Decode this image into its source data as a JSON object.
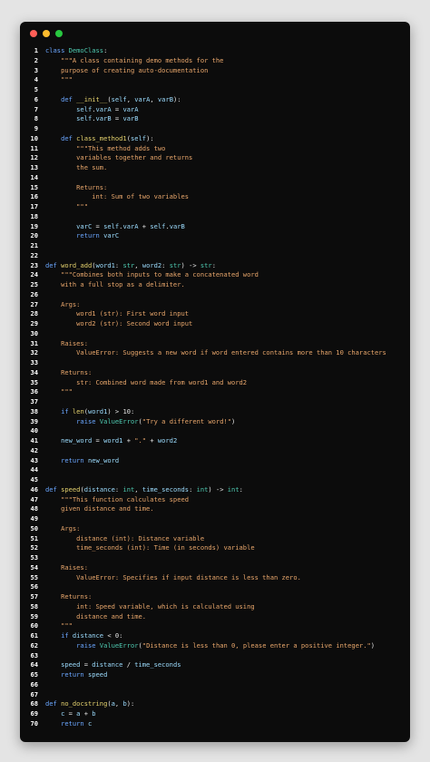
{
  "window": {
    "controls": [
      "close",
      "minimize",
      "maximize"
    ]
  },
  "lines": [
    {
      "n": "1",
      "t": [
        [
          "kw",
          "class "
        ],
        [
          "cls",
          "DemoClass"
        ],
        [
          "plain",
          ":"
        ]
      ]
    },
    {
      "n": "2",
      "t": [
        [
          "str",
          "    \"\"\"A class containing demo methods for the"
        ]
      ]
    },
    {
      "n": "3",
      "t": [
        [
          "str",
          "    purpose of creating auto-documentation"
        ]
      ]
    },
    {
      "n": "4",
      "t": [
        [
          "str",
          "    \"\"\""
        ]
      ]
    },
    {
      "n": "5",
      "t": []
    },
    {
      "n": "6",
      "t": [
        [
          "kw",
          "    def "
        ],
        [
          "fn",
          "__init__"
        ],
        [
          "plain",
          "("
        ],
        [
          "id",
          "self"
        ],
        [
          "plain",
          ", "
        ],
        [
          "id",
          "varA"
        ],
        [
          "plain",
          ", "
        ],
        [
          "id",
          "varB"
        ],
        [
          "plain",
          "):"
        ]
      ]
    },
    {
      "n": "7",
      "t": [
        [
          "id",
          "        self"
        ],
        [
          "plain",
          "."
        ],
        [
          "id",
          "varA"
        ],
        [
          "plain",
          " = "
        ],
        [
          "id",
          "varA"
        ]
      ]
    },
    {
      "n": "8",
      "t": [
        [
          "id",
          "        self"
        ],
        [
          "plain",
          "."
        ],
        [
          "id",
          "varB"
        ],
        [
          "plain",
          " = "
        ],
        [
          "id",
          "varB"
        ]
      ]
    },
    {
      "n": "9",
      "t": []
    },
    {
      "n": "10",
      "t": [
        [
          "kw",
          "    def "
        ],
        [
          "fn",
          "class_method1"
        ],
        [
          "plain",
          "("
        ],
        [
          "id",
          "self"
        ],
        [
          "plain",
          "):"
        ]
      ]
    },
    {
      "n": "11",
      "t": [
        [
          "str",
          "        \"\"\"This method adds two"
        ]
      ]
    },
    {
      "n": "12",
      "t": [
        [
          "str",
          "        variables together and returns"
        ]
      ]
    },
    {
      "n": "13",
      "t": [
        [
          "str",
          "        the sum."
        ]
      ]
    },
    {
      "n": "14",
      "t": []
    },
    {
      "n": "15",
      "t": [
        [
          "str",
          "        Returns:"
        ]
      ]
    },
    {
      "n": "16",
      "t": [
        [
          "str",
          "            int: Sum of two variables"
        ]
      ]
    },
    {
      "n": "17",
      "t": [
        [
          "str",
          "        \"\"\""
        ]
      ]
    },
    {
      "n": "18",
      "t": []
    },
    {
      "n": "19",
      "t": [
        [
          "id",
          "        varC"
        ],
        [
          "plain",
          " = "
        ],
        [
          "id",
          "self"
        ],
        [
          "plain",
          "."
        ],
        [
          "id",
          "varA"
        ],
        [
          "plain",
          " + "
        ],
        [
          "id",
          "self"
        ],
        [
          "plain",
          "."
        ],
        [
          "id",
          "varB"
        ]
      ]
    },
    {
      "n": "20",
      "t": [
        [
          "kw",
          "        return "
        ],
        [
          "id",
          "varC"
        ]
      ]
    },
    {
      "n": "21",
      "t": []
    },
    {
      "n": "22",
      "t": []
    },
    {
      "n": "23",
      "t": [
        [
          "kw",
          "def "
        ],
        [
          "fn",
          "word_add"
        ],
        [
          "plain",
          "("
        ],
        [
          "id",
          "word1"
        ],
        [
          "plain",
          ": "
        ],
        [
          "cls",
          "str"
        ],
        [
          "plain",
          ", "
        ],
        [
          "id",
          "word2"
        ],
        [
          "plain",
          ": "
        ],
        [
          "cls",
          "str"
        ],
        [
          "plain",
          ") -> "
        ],
        [
          "cls",
          "str"
        ],
        [
          "plain",
          ":"
        ]
      ]
    },
    {
      "n": "24",
      "t": [
        [
          "str",
          "    \"\"\"Combines both inputs to make a concatenated word"
        ]
      ]
    },
    {
      "n": "25",
      "t": [
        [
          "str",
          "    with a full stop as a delimiter."
        ]
      ]
    },
    {
      "n": "26",
      "t": []
    },
    {
      "n": "27",
      "t": [
        [
          "str",
          "    Args:"
        ]
      ]
    },
    {
      "n": "28",
      "t": [
        [
          "str",
          "        word1 (str): First word input"
        ]
      ]
    },
    {
      "n": "29",
      "t": [
        [
          "str",
          "        word2 (str): Second word input"
        ]
      ]
    },
    {
      "n": "30",
      "t": []
    },
    {
      "n": "31",
      "t": [
        [
          "str",
          "    Raises:"
        ]
      ]
    },
    {
      "n": "32",
      "t": [
        [
          "str",
          "        ValueError: Suggests a new word if word entered contains more than 10 characters"
        ]
      ]
    },
    {
      "n": "33",
      "t": []
    },
    {
      "n": "34",
      "t": [
        [
          "str",
          "    Returns:"
        ]
      ]
    },
    {
      "n": "35",
      "t": [
        [
          "str",
          "        str: Combined word made from word1 and word2"
        ]
      ]
    },
    {
      "n": "36",
      "t": [
        [
          "str",
          "    \"\"\""
        ]
      ]
    },
    {
      "n": "37",
      "t": []
    },
    {
      "n": "38",
      "t": [
        [
          "kw",
          "    if "
        ],
        [
          "fn",
          "len"
        ],
        [
          "plain",
          "("
        ],
        [
          "id",
          "word1"
        ],
        [
          "plain",
          ") > "
        ],
        [
          "plain",
          "10:"
        ]
      ]
    },
    {
      "n": "39",
      "t": [
        [
          "kw",
          "        raise "
        ],
        [
          "cls",
          "ValueError"
        ],
        [
          "plain",
          "("
        ],
        [
          "str",
          "\"Try a different word!\""
        ],
        [
          "plain",
          ")"
        ]
      ]
    },
    {
      "n": "40",
      "t": []
    },
    {
      "n": "41",
      "t": [
        [
          "id",
          "    new_word"
        ],
        [
          "plain",
          " = "
        ],
        [
          "id",
          "word1"
        ],
        [
          "plain",
          " + "
        ],
        [
          "str",
          "\".\""
        ],
        [
          "plain",
          " + "
        ],
        [
          "id",
          "word2"
        ]
      ]
    },
    {
      "n": "42",
      "t": []
    },
    {
      "n": "43",
      "t": [
        [
          "kw",
          "    return "
        ],
        [
          "id",
          "new_word"
        ]
      ]
    },
    {
      "n": "44",
      "t": []
    },
    {
      "n": "45",
      "t": []
    },
    {
      "n": "46",
      "t": [
        [
          "kw",
          "def "
        ],
        [
          "fn",
          "speed"
        ],
        [
          "plain",
          "("
        ],
        [
          "id",
          "distance"
        ],
        [
          "plain",
          ": "
        ],
        [
          "cls",
          "int"
        ],
        [
          "plain",
          ", "
        ],
        [
          "id",
          "time_seconds"
        ],
        [
          "plain",
          ": "
        ],
        [
          "cls",
          "int"
        ],
        [
          "plain",
          ") -> "
        ],
        [
          "cls",
          "int"
        ],
        [
          "plain",
          ":"
        ]
      ]
    },
    {
      "n": "47",
      "t": [
        [
          "str",
          "    \"\"\"This function calculates speed"
        ]
      ]
    },
    {
      "n": "48",
      "t": [
        [
          "str",
          "    given distance and time."
        ]
      ]
    },
    {
      "n": "49",
      "t": []
    },
    {
      "n": "50",
      "t": [
        [
          "str",
          "    Args:"
        ]
      ]
    },
    {
      "n": "51",
      "t": [
        [
          "str",
          "        distance (int): Distance variable"
        ]
      ]
    },
    {
      "n": "52",
      "t": [
        [
          "str",
          "        time_seconds (int): Time (in seconds) variable"
        ]
      ]
    },
    {
      "n": "53",
      "t": []
    },
    {
      "n": "54",
      "t": [
        [
          "str",
          "    Raises:"
        ]
      ]
    },
    {
      "n": "55",
      "t": [
        [
          "str",
          "        ValueError: Specifies if input distance is less than zero."
        ]
      ]
    },
    {
      "n": "56",
      "t": []
    },
    {
      "n": "57",
      "t": [
        [
          "str",
          "    Returns:"
        ]
      ]
    },
    {
      "n": "58",
      "t": [
        [
          "str",
          "        int: Speed variable, which is calculated using"
        ]
      ]
    },
    {
      "n": "59",
      "t": [
        [
          "str",
          "        distance and time."
        ]
      ]
    },
    {
      "n": "60",
      "t": [
        [
          "str",
          "    \"\"\""
        ]
      ]
    },
    {
      "n": "61",
      "t": [
        [
          "kw",
          "    if "
        ],
        [
          "id",
          "distance"
        ],
        [
          "plain",
          " < 0:"
        ]
      ]
    },
    {
      "n": "62",
      "t": [
        [
          "kw",
          "        raise "
        ],
        [
          "cls",
          "ValueError"
        ],
        [
          "plain",
          "("
        ],
        [
          "str",
          "\"Distance is less than 0, please enter a positive integer.\""
        ],
        [
          "plain",
          ")"
        ]
      ]
    },
    {
      "n": "63",
      "t": []
    },
    {
      "n": "64",
      "t": [
        [
          "id",
          "    speed"
        ],
        [
          "plain",
          " = "
        ],
        [
          "id",
          "distance"
        ],
        [
          "plain",
          " / "
        ],
        [
          "id",
          "time_seconds"
        ]
      ]
    },
    {
      "n": "65",
      "t": [
        [
          "kw",
          "    return "
        ],
        [
          "id",
          "speed"
        ]
      ]
    },
    {
      "n": "66",
      "t": []
    },
    {
      "n": "67",
      "t": []
    },
    {
      "n": "68",
      "t": [
        [
          "kw",
          "def "
        ],
        [
          "fn",
          "no_docstring"
        ],
        [
          "plain",
          "("
        ],
        [
          "id",
          "a"
        ],
        [
          "plain",
          ", "
        ],
        [
          "id",
          "b"
        ],
        [
          "plain",
          "):"
        ]
      ]
    },
    {
      "n": "69",
      "t": [
        [
          "id",
          "    c"
        ],
        [
          "plain",
          " = "
        ],
        [
          "id",
          "a"
        ],
        [
          "plain",
          " + "
        ],
        [
          "id",
          "b"
        ]
      ]
    },
    {
      "n": "70",
      "t": [
        [
          "kw",
          "    return "
        ],
        [
          "id",
          "c"
        ]
      ]
    }
  ]
}
